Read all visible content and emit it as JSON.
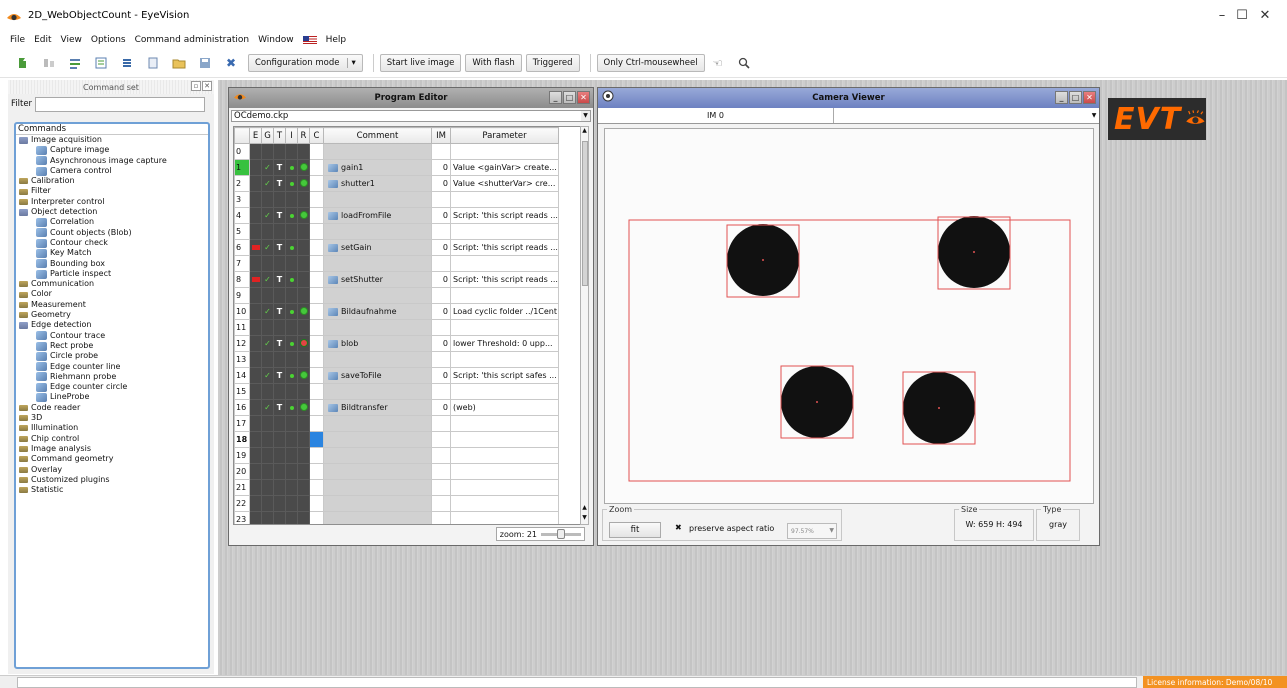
{
  "window": {
    "title": "2D_WebObjectCount - EyeVision",
    "minimize": "–",
    "maximize": "☐",
    "close": "✕"
  },
  "menu": [
    "File",
    "Edit",
    "View",
    "Options",
    "Command administration",
    "Window",
    "Help"
  ],
  "toolbar": {
    "config_mode": "Configuration mode",
    "config_dd": "▾",
    "start_live": "Start live image",
    "with_flash": "With flash",
    "triggered": "Triggered",
    "only_ctrl": "Only Ctrl-mousewheel"
  },
  "left": {
    "title": "Command set",
    "filter_label": "Filter",
    "filter_value": "",
    "root": "Commands",
    "tree": [
      {
        "label": "Image acquisition",
        "level": 0,
        "icon": "folder-open"
      },
      {
        "label": "Capture image",
        "level": 1,
        "icon": "leaf"
      },
      {
        "label": "Asynchronous image capture",
        "level": 1,
        "icon": "leaf"
      },
      {
        "label": "Camera control",
        "level": 1,
        "icon": "leaf"
      },
      {
        "label": "Calibration",
        "level": 0,
        "icon": "folder"
      },
      {
        "label": "Filter",
        "level": 0,
        "icon": "folder"
      },
      {
        "label": "Interpreter control",
        "level": 0,
        "icon": "folder"
      },
      {
        "label": "Object detection",
        "level": 0,
        "icon": "folder-open"
      },
      {
        "label": "Correlation",
        "level": 1,
        "icon": "leaf"
      },
      {
        "label": "Count objects (Blob)",
        "level": 1,
        "icon": "leaf"
      },
      {
        "label": "Contour check",
        "level": 1,
        "icon": "leaf"
      },
      {
        "label": "Key Match",
        "level": 1,
        "icon": "leaf"
      },
      {
        "label": "Bounding box",
        "level": 1,
        "icon": "leaf"
      },
      {
        "label": "Particle inspect",
        "level": 1,
        "icon": "leaf"
      },
      {
        "label": "Communication",
        "level": 0,
        "icon": "folder"
      },
      {
        "label": "Color",
        "level": 0,
        "icon": "folder"
      },
      {
        "label": "Measurement",
        "level": 0,
        "icon": "folder"
      },
      {
        "label": "Geometry",
        "level": 0,
        "icon": "folder"
      },
      {
        "label": "Edge detection",
        "level": 0,
        "icon": "folder-open"
      },
      {
        "label": "Contour trace",
        "level": 1,
        "icon": "leaf"
      },
      {
        "label": "Rect probe",
        "level": 1,
        "icon": "leaf"
      },
      {
        "label": "Circle probe",
        "level": 1,
        "icon": "leaf"
      },
      {
        "label": "Edge counter line",
        "level": 1,
        "icon": "leaf"
      },
      {
        "label": "Riehmann probe",
        "level": 1,
        "icon": "leaf"
      },
      {
        "label": "Edge counter circle",
        "level": 1,
        "icon": "leaf"
      },
      {
        "label": "LineProbe",
        "level": 1,
        "icon": "leaf"
      },
      {
        "label": "Code reader",
        "level": 0,
        "icon": "folder"
      },
      {
        "label": "3D",
        "level": 0,
        "icon": "folder"
      },
      {
        "label": "Illumination",
        "level": 0,
        "icon": "folder"
      },
      {
        "label": "Chip control",
        "level": 0,
        "icon": "folder"
      },
      {
        "label": "Image analysis",
        "level": 0,
        "icon": "folder"
      },
      {
        "label": "Command geometry",
        "level": 0,
        "icon": "folder"
      },
      {
        "label": "Overlay",
        "level": 0,
        "icon": "folder"
      },
      {
        "label": "Customized plugins",
        "level": 0,
        "icon": "folder"
      },
      {
        "label": "Statistic",
        "level": 0,
        "icon": "folder"
      }
    ]
  },
  "program_editor": {
    "title": "Program Editor",
    "file": "OCdemo.ckp",
    "columns": [
      "",
      "E",
      "G",
      "T",
      "I",
      "R",
      "C",
      "Comment",
      "IM",
      "Parameter"
    ],
    "rows": [
      {
        "n": "0",
        "e": "",
        "g": "",
        "t": "",
        "i": "",
        "r": "",
        "comment": "",
        "im": "",
        "param": ""
      },
      {
        "n": "1",
        "e": "",
        "g": "✓",
        "t": "T",
        "i": "•",
        "r": "●",
        "comment": "gain1",
        "im": "0",
        "param": "Value <gainVar> create..."
      },
      {
        "n": "2",
        "e": "",
        "g": "✓",
        "t": "T",
        "i": "•",
        "r": "●",
        "comment": "shutter1",
        "im": "0",
        "param": "Value <shutterVar> cre..."
      },
      {
        "n": "3",
        "e": "",
        "g": "",
        "t": "",
        "i": "",
        "r": "",
        "comment": "",
        "im": "",
        "param": ""
      },
      {
        "n": "4",
        "e": "",
        "g": "✓",
        "t": "T",
        "i": "•",
        "r": "●",
        "comment": "loadFromFile",
        "im": "0",
        "param": "Script: 'this script reads ..."
      },
      {
        "n": "5",
        "e": "",
        "g": "",
        "t": "",
        "i": "",
        "r": "",
        "comment": "",
        "im": "",
        "param": ""
      },
      {
        "n": "6",
        "e": "▬",
        "g": "✓",
        "t": "T",
        "i": "•",
        "r": "",
        "comment": "setGain",
        "im": "0",
        "param": "Script: 'this script reads ..."
      },
      {
        "n": "7",
        "e": "",
        "g": "",
        "t": "",
        "i": "",
        "r": "",
        "comment": "",
        "im": "",
        "param": ""
      },
      {
        "n": "8",
        "e": "▬",
        "g": "✓",
        "t": "T",
        "i": "•",
        "r": "",
        "comment": "setShutter",
        "im": "0",
        "param": "Script: 'this script reads ..."
      },
      {
        "n": "9",
        "e": "",
        "g": "",
        "t": "",
        "i": "",
        "r": "",
        "comment": "",
        "im": "",
        "param": ""
      },
      {
        "n": "10",
        "e": "",
        "g": "✓",
        "t": "T",
        "i": "•",
        "r": "●",
        "comment": "Bildaufnahme",
        "im": "0",
        "param": "Load cyclic folder ../1Cent"
      },
      {
        "n": "11",
        "e": "",
        "g": "",
        "t": "",
        "i": "",
        "r": "",
        "comment": "",
        "im": "",
        "param": ""
      },
      {
        "n": "12",
        "e": "",
        "g": "✓",
        "t": "T",
        "i": "•",
        "r": "◉",
        "comment": "blob",
        "im": "0",
        "param": "lower Threshold: 0 upp..."
      },
      {
        "n": "13",
        "e": "",
        "g": "",
        "t": "",
        "i": "",
        "r": "",
        "comment": "",
        "im": "",
        "param": ""
      },
      {
        "n": "14",
        "e": "",
        "g": "✓",
        "t": "T",
        "i": "•",
        "r": "●",
        "comment": "saveToFile",
        "im": "0",
        "param": "Script: 'this script safes ..."
      },
      {
        "n": "15",
        "e": "",
        "g": "",
        "t": "",
        "i": "",
        "r": "",
        "comment": "",
        "im": "",
        "param": ""
      },
      {
        "n": "16",
        "e": "",
        "g": "✓",
        "t": "T",
        "i": "•",
        "r": "●",
        "comment": "Bildtransfer",
        "im": "0",
        "param": "(web)"
      },
      {
        "n": "17",
        "e": "",
        "g": "",
        "t": "",
        "i": "",
        "r": "",
        "comment": "",
        "im": "",
        "param": ""
      },
      {
        "n": "18",
        "e": "",
        "g": "",
        "t": "",
        "i": "",
        "r": "",
        "comment": "",
        "im": "",
        "param": ""
      },
      {
        "n": "19",
        "e": "",
        "g": "",
        "t": "",
        "i": "",
        "r": "",
        "comment": "",
        "im": "",
        "param": ""
      },
      {
        "n": "20",
        "e": "",
        "g": "",
        "t": "",
        "i": "",
        "r": "",
        "comment": "",
        "im": "",
        "param": ""
      },
      {
        "n": "21",
        "e": "",
        "g": "",
        "t": "",
        "i": "",
        "r": "",
        "comment": "",
        "im": "",
        "param": ""
      },
      {
        "n": "22",
        "e": "",
        "g": "",
        "t": "",
        "i": "",
        "r": "",
        "comment": "",
        "im": "",
        "param": ""
      },
      {
        "n": "23",
        "e": "",
        "g": "",
        "t": "",
        "i": "",
        "r": "",
        "comment": "",
        "im": "",
        "param": ""
      }
    ],
    "zoom": "zoom: 21"
  },
  "camera_viewer": {
    "title": "Camera Viewer",
    "tab": "IM 0",
    "zoom_legend": "Zoom",
    "fit": "fit",
    "preserve_check": "✖",
    "preserve_label": "preserve aspect ratio",
    "zoom_value": "97.57%",
    "size_legend": "Size",
    "size_value": "W: 659  H: 494",
    "type_legend": "Type",
    "type_value": "gray"
  },
  "logo": "EVT",
  "status": {
    "license": "License information: Demo/08/10"
  },
  "colors": {
    "accent_blue": "#2a84e0",
    "green": "#37c13f",
    "orange": "#f39222",
    "roi_red": "#e05252"
  }
}
